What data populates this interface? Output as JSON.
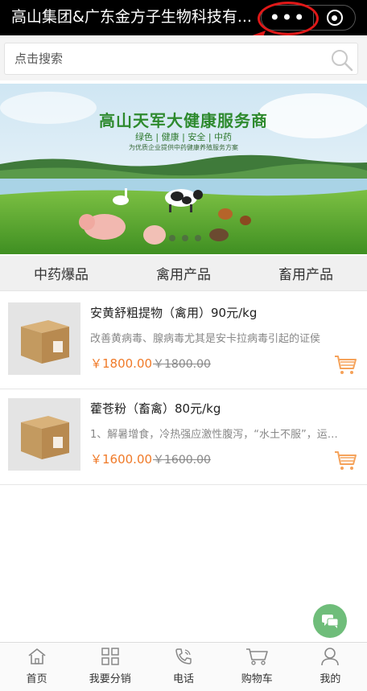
{
  "titlebar": {
    "title": "高山集团&广东金方子生物科技有...",
    "more_label": "•••"
  },
  "search": {
    "placeholder": "点击搜索"
  },
  "banner": {
    "title": "高山天军大健康服务商",
    "tags": "绿色 | 健康 | 安全 | 中药",
    "subtitle": "为优质企业提供中药健康养殖服务方案"
  },
  "tabs": [
    {
      "label": "中药爆品"
    },
    {
      "label": "禽用产品"
    },
    {
      "label": "畜用产品"
    }
  ],
  "products": [
    {
      "name": "安黄舒粗提物（禽用）90元/kg",
      "description": "改善黄病毒、腺病毒尤其是安卡拉病毒引起的证侯",
      "price": "￥1800.00",
      "original_price": "￥1800.00"
    },
    {
      "name": "藿苍粉（畜禽）80元/kg",
      "description": "1、解暑增食，冷热强应激性腹泻，“水土不服”，运…",
      "price": "￥1600.00",
      "original_price": "￥1600.00"
    }
  ],
  "bottom_nav": [
    {
      "label": "首页",
      "icon": "home-icon"
    },
    {
      "label": "我要分销",
      "icon": "grid-icon"
    },
    {
      "label": "电话",
      "icon": "phone-icon"
    },
    {
      "label": "购物车",
      "icon": "cart-icon"
    },
    {
      "label": "我的",
      "icon": "user-icon"
    }
  ],
  "colors": {
    "accent_price": "#f07a28",
    "annotation_red": "#e01818",
    "chat_fab": "#6fbd7a"
  }
}
